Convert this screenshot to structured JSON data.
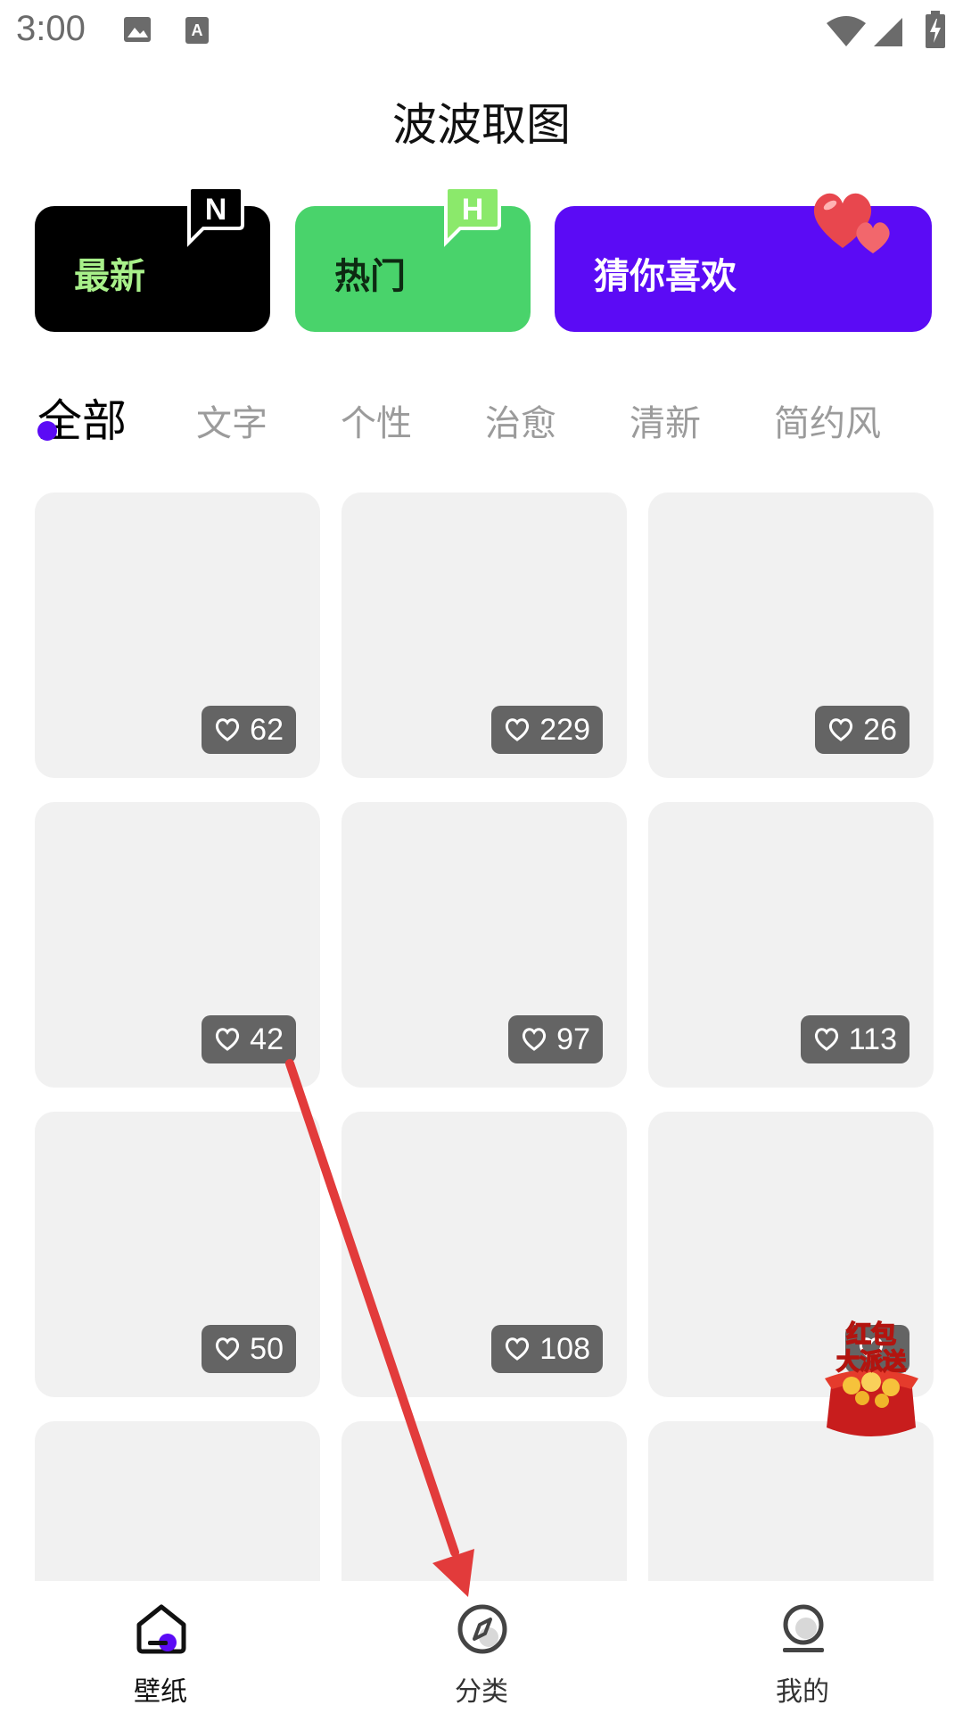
{
  "status_bar": {
    "time": "3:00",
    "icons": [
      "image-icon",
      "font-a-icon",
      "wifi-icon",
      "cell-signal-icon",
      "battery-charging-icon"
    ]
  },
  "app": {
    "title": "波波取图"
  },
  "cards": [
    {
      "label": "最新",
      "badge": "N",
      "color": "#000000"
    },
    {
      "label": "热门",
      "badge": "H",
      "color": "#49d36b"
    },
    {
      "label": "猜你喜欢",
      "badge": "heart-icon",
      "color": "#5b0bf5"
    }
  ],
  "tabs": [
    "全部",
    "文字",
    "个性",
    "治愈",
    "清新",
    "简约风"
  ],
  "active_tab": "全部",
  "tiles": [
    {
      "likes": "62"
    },
    {
      "likes": "229"
    },
    {
      "likes": "26"
    },
    {
      "likes": "42"
    },
    {
      "likes": "97"
    },
    {
      "likes": "113"
    },
    {
      "likes": "50"
    },
    {
      "likes": "108"
    },
    {
      "likes": ""
    },
    {
      "likes": ""
    },
    {
      "likes": ""
    },
    {
      "likes": ""
    }
  ],
  "promo": {
    "line1": "红包",
    "line2": "大派送"
  },
  "bottom_nav": [
    {
      "label": "壁纸",
      "icon": "home-icon",
      "active": true
    },
    {
      "label": "分类",
      "icon": "compass-icon",
      "active": false
    },
    {
      "label": "我的",
      "icon": "profile-icon",
      "active": false
    }
  ],
  "accent_color": "#5b0bf5"
}
